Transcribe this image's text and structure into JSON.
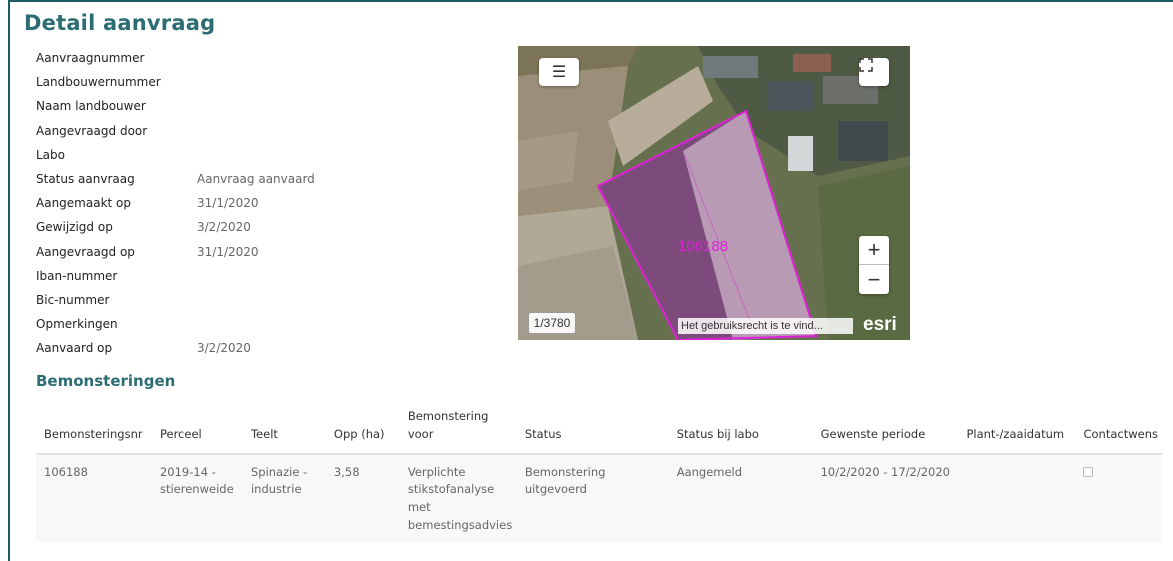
{
  "page": {
    "title": "Detail aanvraag"
  },
  "details": [
    {
      "label": "Aanvraagnummer",
      "value": ""
    },
    {
      "label": "Landbouwernummer",
      "value": ""
    },
    {
      "label": "Naam landbouwer",
      "value": ""
    },
    {
      "label": "Aangevraagd door",
      "value": ""
    },
    {
      "label": "Labo",
      "value": ""
    },
    {
      "label": "Status aanvraag",
      "value": "Aanvraag aanvaard"
    },
    {
      "label": "Aangemaakt op",
      "value": "31/1/2020"
    },
    {
      "label": "Gewijzigd op",
      "value": "3/2/2020"
    },
    {
      "label": "Aangevraagd op",
      "value": "31/1/2020"
    },
    {
      "label": "Iban-nummer",
      "value": ""
    },
    {
      "label": "Bic-nummer",
      "value": ""
    },
    {
      "label": "Opmerkingen",
      "value": ""
    },
    {
      "label": "Aanvaard op",
      "value": "3/2/2020"
    }
  ],
  "map": {
    "layers_icon": "list-icon",
    "fullscreen_icon": "expand-icon",
    "zoom_in": "+",
    "zoom_out": "−",
    "scale": "1/3780",
    "attribution": "Het gebruiksrecht is te vind...",
    "logo": "esri",
    "parcel_label": "106188",
    "parcel_color": "#e020d8"
  },
  "section": {
    "title": "Bemonsteringen"
  },
  "table": {
    "headers": [
      "Bemonsteringsnr",
      "Perceel",
      "Teelt",
      "Opp (ha)",
      "Bemonstering voor",
      "Status",
      "Status bij labo",
      "Gewenste periode",
      "Plant-/zaaidatum",
      "Contactwens"
    ],
    "rows": [
      {
        "nr": "106188",
        "perceel": "2019-14 - stierenweide",
        "teelt": "Spinazie - industrie",
        "opp": "3,58",
        "voor": "Verplichte stikstofanalyse met bemestingsadvies",
        "status": "Bemonstering uitgevoerd",
        "status_labo": "Aangemeld",
        "periode": "10/2/2020 - 17/2/2020",
        "datum": "",
        "contactwens": false
      }
    ]
  }
}
